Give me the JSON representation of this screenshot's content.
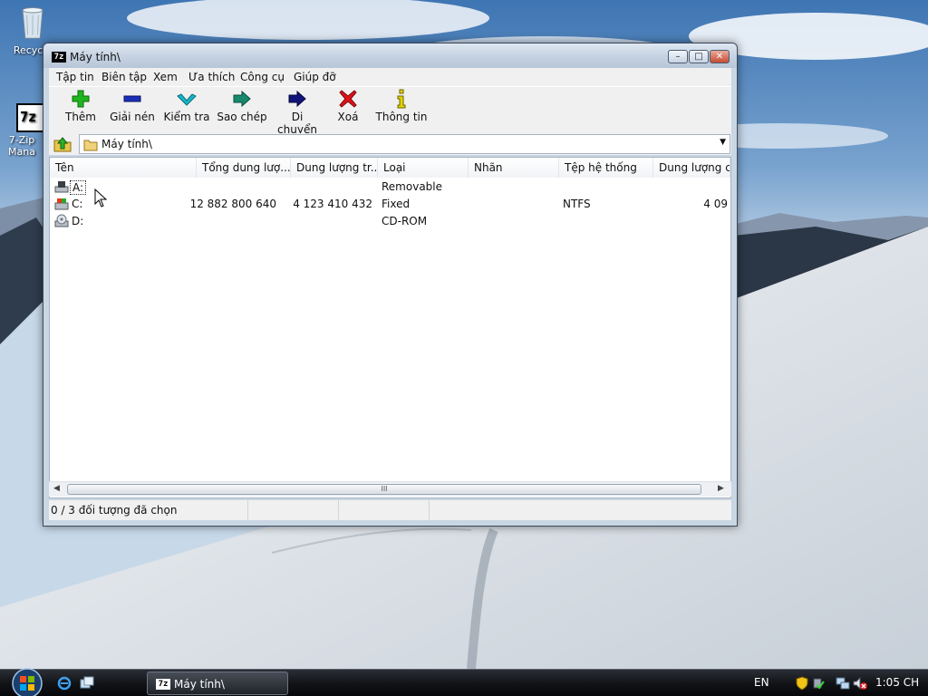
{
  "window": {
    "title": "Máy tính\\",
    "app_icon_text": "7z",
    "buttons": {
      "minimize": "–",
      "maximize": "□",
      "close": "✕"
    }
  },
  "menu": [
    "Tập tin",
    "Biên tập",
    "Xem",
    "Ưa thích",
    "Công cụ",
    "Giúp đỡ"
  ],
  "toolbar": [
    {
      "label": "Thêm",
      "icon": "plus-icon",
      "color": "#1fb51f"
    },
    {
      "label": "Giải nén",
      "icon": "minus-icon",
      "color": "#1a2fb8"
    },
    {
      "label": "Kiểm tra",
      "icon": "check-icon",
      "color": "#17b7c9"
    },
    {
      "label": "Sao chép",
      "icon": "copy-arrow-icon",
      "color": "#178a6e"
    },
    {
      "label": "Di chuyển",
      "icon": "move-arrow-icon",
      "color": "#12147a"
    },
    {
      "label": "Xoá",
      "icon": "delete-x-icon",
      "color": "#e0121a"
    },
    {
      "label": "Thông tin",
      "icon": "info-icon",
      "color": "#e3d300"
    }
  ],
  "address": {
    "path": "Máy tính\\"
  },
  "columns": [
    "Tên",
    "Tổng dung lượ...",
    "Dung lượng tr...",
    "Loại",
    "Nhãn",
    "Tệp hệ thống",
    "Dung lượng cl..."
  ],
  "rows": [
    {
      "name": "A:",
      "total": "",
      "free": "",
      "type": "Removable",
      "label": "",
      "fs": "",
      "cluster": ""
    },
    {
      "name": "C:",
      "total": "12 882 800 640",
      "free": "4 123 410 432",
      "type": "Fixed",
      "label": "",
      "fs": "NTFS",
      "cluster": "4 09"
    },
    {
      "name": "D:",
      "total": "",
      "free": "",
      "type": "CD-ROM",
      "label": "",
      "fs": "",
      "cluster": ""
    }
  ],
  "scrollbar": {
    "thumb_grip": "III"
  },
  "status": {
    "selected": "0 / 3 đối tượng đã chọn"
  },
  "desktop": {
    "icons": [
      {
        "label": "Recycle"
      },
      {
        "label": "7-Zip Mana",
        "glyph_text": "7z"
      }
    ]
  },
  "taskbar": {
    "task_label": "Máy tính\\",
    "task_icon_text": "7z",
    "language": "EN",
    "clock": "1:05 CH"
  }
}
